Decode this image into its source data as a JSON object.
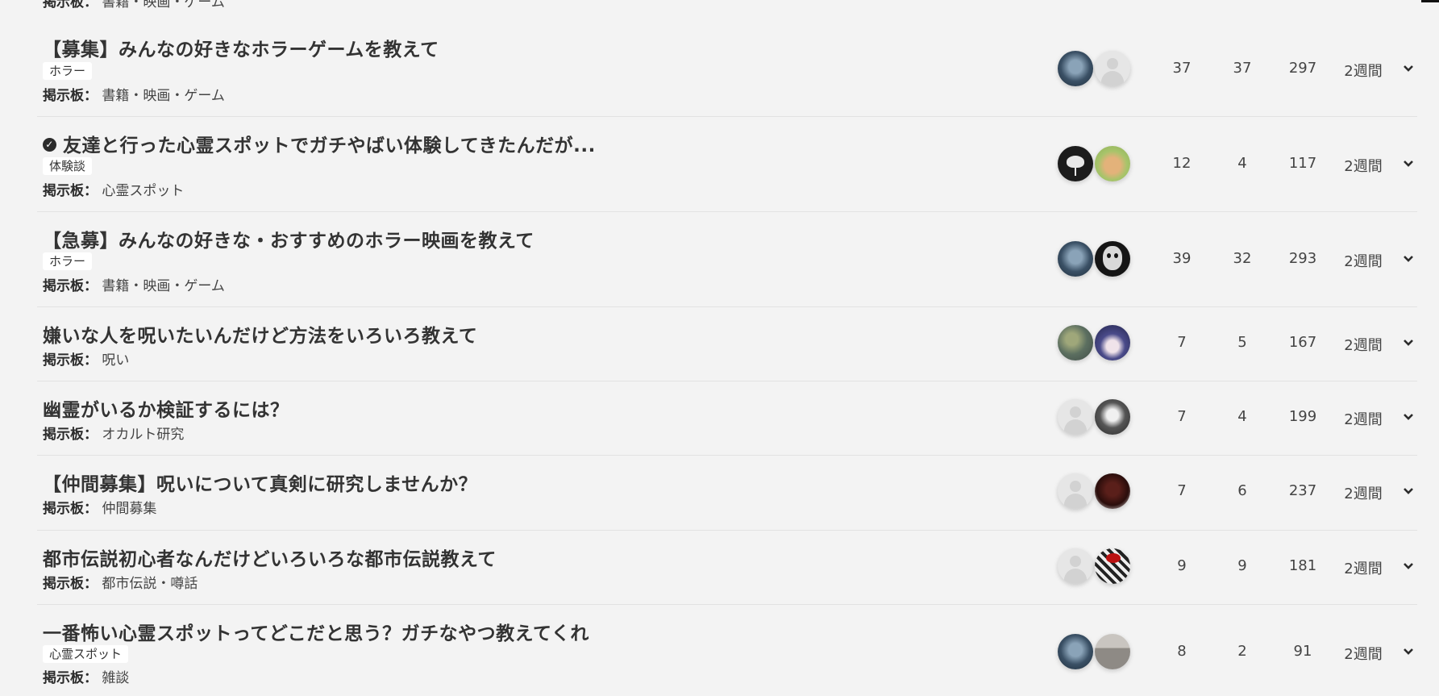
{
  "board_label": "掲示板：",
  "top_partial": {
    "board": "書籍・映画・ゲーム"
  },
  "threads": [
    {
      "title": "【募集】みんなの好きなホラーゲームを教えて",
      "tag": "ホラー",
      "board": "書籍・映画・ゲーム",
      "replies": "37",
      "users": "37",
      "views": "297",
      "age": "2週間",
      "solved": false,
      "avatars": [
        "blue-clown-avatar",
        "default-user-avatar"
      ]
    },
    {
      "title": "友達と行った心霊スポットでガチやばい体験してきたんだが...",
      "tag": "体験談",
      "board": "心霊スポット",
      "replies": "12",
      "users": "4",
      "views": "117",
      "age": "2週間",
      "solved": true,
      "avatars": [
        "ghost-lamp-avatar",
        "dog-avatar"
      ]
    },
    {
      "title": "【急募】みんなの好きな・おすすめのホラー映画を教えて",
      "tag": "ホラー",
      "board": "書籍・映画・ゲーム",
      "replies": "39",
      "users": "32",
      "views": "293",
      "age": "2週間",
      "solved": false,
      "avatars": [
        "blue-clown-avatar",
        "skull-avatar"
      ]
    },
    {
      "title": "嫌いな人を呪いたいんだけど方法をいろいろ教えて",
      "tag": "",
      "board": "呪い",
      "replies": "7",
      "users": "5",
      "views": "167",
      "age": "2週間",
      "solved": false,
      "avatars": [
        "painting-avatar",
        "anime-girl-avatar"
      ]
    },
    {
      "title": "幽霊がいるか検証するには？",
      "tag": "",
      "board": "オカルト研究",
      "replies": "7",
      "users": "4",
      "views": "199",
      "age": "2週間",
      "solved": false,
      "avatars": [
        "default-user-avatar",
        "bw-woman-avatar"
      ]
    },
    {
      "title": "【仲間募集】呪いについて真剣に研究しませんか？",
      "tag": "",
      "board": "仲間募集",
      "replies": "7",
      "users": "6",
      "views": "237",
      "age": "2週間",
      "solved": false,
      "avatars": [
        "default-user-avatar",
        "red-face-avatar"
      ]
    },
    {
      "title": "都市伝説初心者なんだけどいろいろな都市伝説教えて",
      "tag": "",
      "board": "都市伝説・噂話",
      "replies": "9",
      "users": "9",
      "views": "181",
      "age": "2週間",
      "solved": false,
      "avatars": [
        "default-user-avatar",
        "manga-avatar"
      ]
    },
    {
      "title": "一番怖い心霊スポットってどこだと思う？ガチなやつ教えてくれ",
      "tag": "心霊スポット",
      "board": "雑談",
      "replies": "8",
      "users": "2",
      "views": "91",
      "age": "2週間",
      "solved": false,
      "avatars": [
        "blue-clown-avatar",
        "building-avatar"
      ]
    }
  ]
}
